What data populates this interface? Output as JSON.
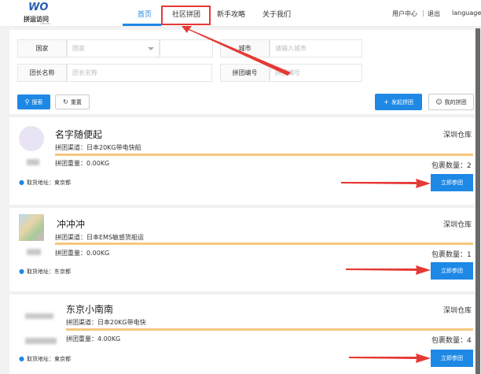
{
  "header": {
    "logo_mark": "WO",
    "logo_text": "拼运访问",
    "logo_sub": "PINYUN",
    "nav": [
      {
        "label": "首页",
        "active": true
      },
      {
        "label": "社区拼团",
        "active": false
      },
      {
        "label": "新手攻略",
        "active": false
      },
      {
        "label": "关于我们",
        "active": false
      }
    ],
    "user_center": "用户中心",
    "separator": "|",
    "logout": "退出",
    "language": "language"
  },
  "filters": {
    "country_label": "国家",
    "country_placeholder": "国家",
    "city_label": "城市",
    "city_placeholder": "请输入城市",
    "leader_label": "团长名称",
    "leader_placeholder": "团长名称",
    "group_no_label": "拼团编号",
    "group_no_placeholder": "拼团编号"
  },
  "actions": {
    "search": "搜索",
    "reset": "重置",
    "create_group": "发起拼团",
    "my_groups": "我的拼团"
  },
  "cards": [
    {
      "title": "名字随便起",
      "channel_label": "拼团渠道：",
      "channel": "日本20KG带电快船",
      "weight_label": "拼团重量：",
      "weight": "0.00KG",
      "warehouse": "深圳仓库",
      "count_label": "包裹数量：",
      "count": "2",
      "address_label": "取货地址：",
      "address": "東京都",
      "join": "立即参团",
      "progress": 1.0
    },
    {
      "title": "冲冲冲",
      "channel_label": "拼团渠道：",
      "channel": "日本EMS敏感货船运",
      "weight_label": "拼团重量：",
      "weight": "0.00KG",
      "warehouse": "深圳仓库",
      "count_label": "包裹数量：",
      "count": "1",
      "address_label": "取货地址：",
      "address": "东京都",
      "join": "立即参团",
      "progress": 1.0
    },
    {
      "title": "东京小南南",
      "channel_label": "拼团渠道：",
      "channel": "日本20KG带电快",
      "weight_label": "拼团重量：",
      "weight": "4.00KG",
      "warehouse": "深圳仓库",
      "count_label": "包裹数量：",
      "count": "4",
      "address_label": "取货地址：",
      "address": "東京都",
      "join": "立即参团",
      "progress": 1.0
    }
  ],
  "colors": {
    "accent": "#1e88e5",
    "annotation": "#e53935",
    "progress": "#f7c77f"
  }
}
